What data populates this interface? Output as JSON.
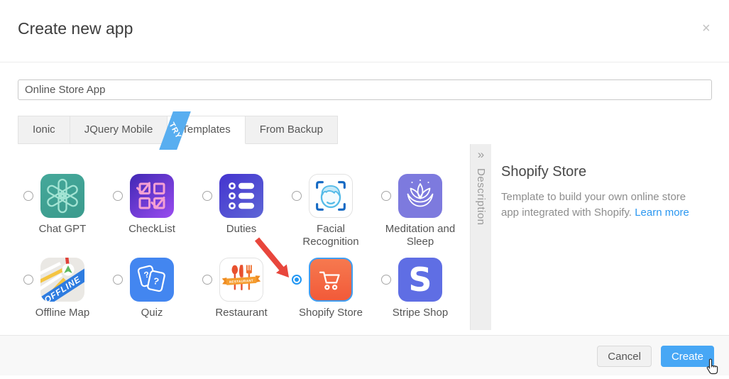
{
  "header": {
    "title": "Create new app",
    "close_icon": "×"
  },
  "name_input": {
    "value": "Online Store App"
  },
  "tabs": [
    {
      "label": "Ionic",
      "active": false
    },
    {
      "label": "JQuery Mobile",
      "active": false
    },
    {
      "label": "Templates",
      "active": true,
      "ribbon": "TRY"
    },
    {
      "label": "From Backup",
      "active": false
    }
  ],
  "templates": [
    {
      "name": "Chat GPT",
      "selected": false
    },
    {
      "name": "CheckList",
      "selected": false
    },
    {
      "name": "Duties",
      "selected": false
    },
    {
      "name": "Facial Recognition",
      "selected": false
    },
    {
      "name": "Meditation and Sleep",
      "selected": false
    },
    {
      "name": "Offline Map",
      "selected": false,
      "badge": "OFFLINE"
    },
    {
      "name": "Quiz",
      "selected": false,
      "symbol": "?"
    },
    {
      "name": "Restaurant",
      "selected": false,
      "badge": "RESTAURANT"
    },
    {
      "name": "Shopify Store",
      "selected": true
    },
    {
      "name": "Stripe Shop",
      "selected": false,
      "letter": "S"
    }
  ],
  "description_panel": {
    "expand_icon": "»",
    "tab_label": "Description",
    "heading": "Shopify Store",
    "body": "Template to build your own online store app integrated with Shopify.",
    "link_label": "Learn more"
  },
  "footer": {
    "cancel_label": "Cancel",
    "create_label": "Create"
  },
  "colors": {
    "accent": "#47a7f5",
    "link": "#2b97f0",
    "selected_border": "#3f9ef2",
    "ribbon": "#58aef0",
    "arrow": "#e8463c"
  }
}
